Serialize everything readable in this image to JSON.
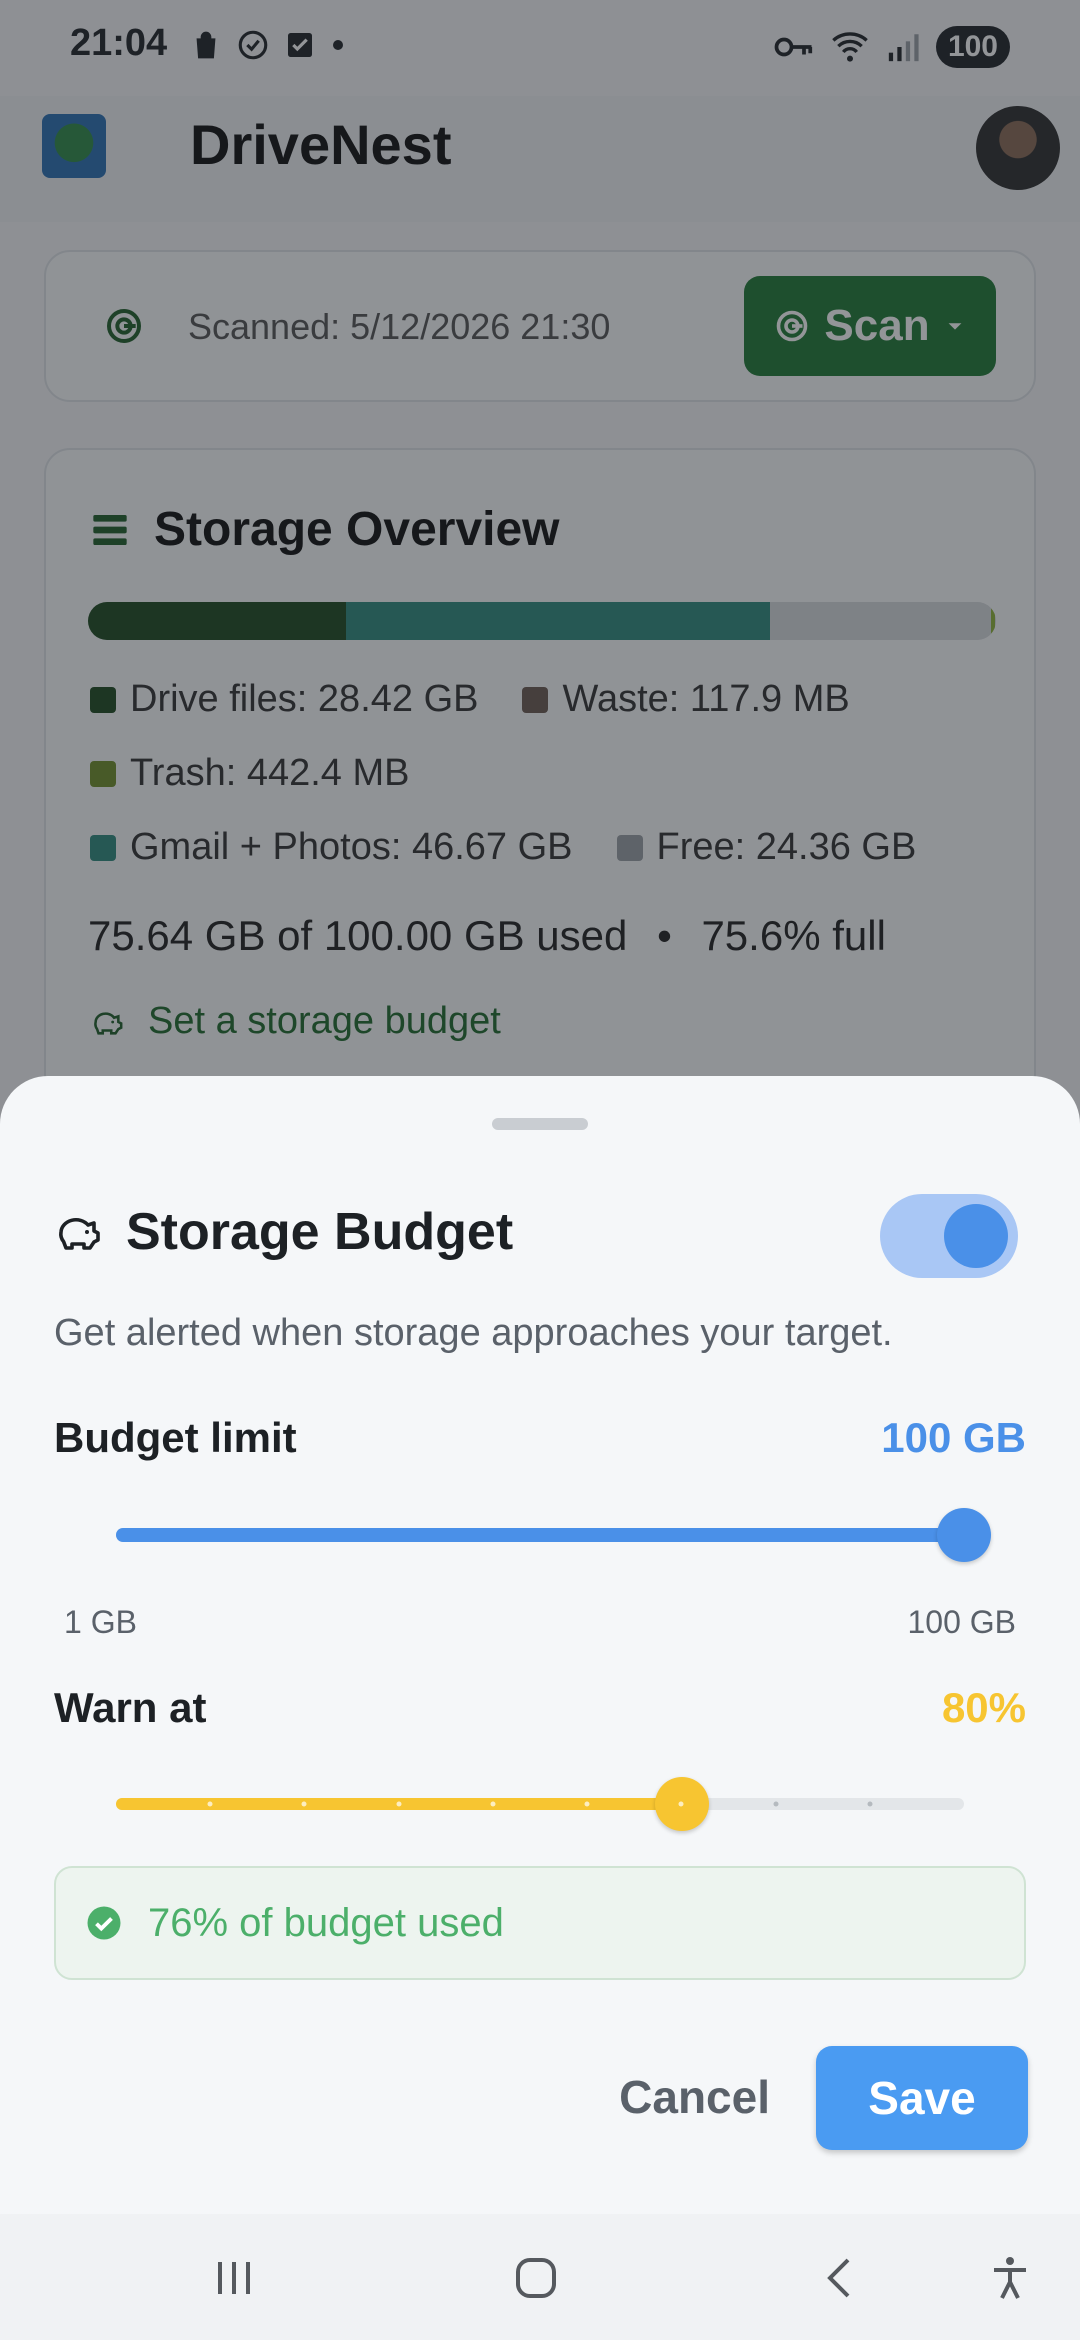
{
  "status_bar": {
    "time": "21:04",
    "battery": "100",
    "left_icons": [
      "shopping-bag-icon",
      "check-circle-icon",
      "checkbox-icon",
      "dot-icon"
    ],
    "right_icons": [
      "vpn-key-icon",
      "wifi-icon",
      "signal-icon"
    ]
  },
  "app_bar": {
    "title": "DriveNest"
  },
  "scan_card": {
    "scanned_text": "Scanned: 5/12/2026 21:30",
    "scan_button": "Scan"
  },
  "overview": {
    "title": "Storage Overview",
    "bar": {
      "drive_files_pct": 28.42,
      "gmail_photos_pct": 46.67,
      "free_pct": 24.36,
      "trash_pct": 0.44
    },
    "legend": [
      {
        "label": "Drive files: 28.42 GB",
        "color": "#1d4a1f"
      },
      {
        "label": "Waste: 117.9 MB",
        "color": "#6b5a52"
      },
      {
        "label": "Trash: 442.4 MB",
        "color": "#6f8f2a"
      },
      {
        "label": "Gmail + Photos: 46.67 GB",
        "color": "#2f8a7e"
      },
      {
        "label": "Free: 24.36 GB",
        "color": "#9aa0a5"
      }
    ],
    "usage_text": "75.64 GB of 100.00 GB used",
    "usage_separator": "•",
    "full_text": "75.6% full",
    "budget_link": "Set a storage budget"
  },
  "sheet": {
    "title": "Storage Budget",
    "toggle_on": true,
    "description": "Get alerted when storage approaches your target.",
    "budget": {
      "label": "Budget limit",
      "value_text": "100 GB",
      "value": 100,
      "min": 1,
      "max": 100,
      "min_label": "1 GB",
      "max_label": "100 GB",
      "color": "#4a90e8"
    },
    "warn": {
      "label": "Warn at",
      "value_text": "80%",
      "fraction": 0.667,
      "steps": 9,
      "color": "#f7c531"
    },
    "status_text": "76% of budget used",
    "cancel": "Cancel",
    "save": "Save"
  },
  "nav_bar": {
    "items": [
      "recents-icon",
      "home-icon",
      "back-icon",
      "accessibility-icon"
    ]
  }
}
